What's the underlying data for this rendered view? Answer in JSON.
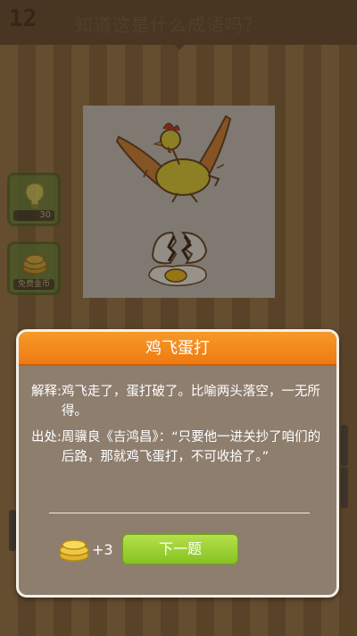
{
  "header": {
    "level": "12",
    "question": "知道这是什么成语吗？"
  },
  "side_buttons": {
    "hint_cost": "30",
    "free_coins_label": "免费金币"
  },
  "dialog": {
    "title": "鸡飞蛋打",
    "explanation_label": "解释:",
    "explanation_text": "鸡飞走了，蛋打破了。比喻两头落空，一无所得。",
    "source_label": "出处:",
    "source_text": "周骥良《吉鸿昌》：“只要他一进关抄了咱们的后路，那就鸡飞蛋打，不可收拾了。”",
    "reward_amount": "+3",
    "next_label": "下一题"
  },
  "colors": {
    "header_orange": "#f08a1c",
    "next_button_green": "#9ccf33",
    "dialog_bg": "#8e7e6e"
  },
  "icons": {
    "hint": "lightbulb-icon",
    "free_coins": "coin-stack-icon",
    "reward": "gold-coins-icon"
  }
}
